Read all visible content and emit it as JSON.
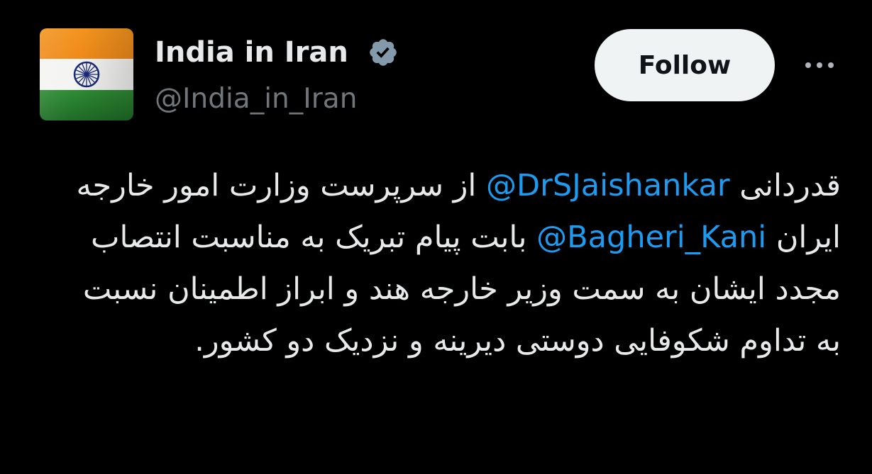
{
  "author": {
    "display_name": "India in Iran",
    "handle": "@India_in_Iran",
    "avatar_icon": "india-flag-icon",
    "verified_icon": "verified-badge-icon"
  },
  "actions": {
    "follow_label": "Follow",
    "more_icon": "more-horizontal-icon"
  },
  "tweet": {
    "text_part_1": "قدردانی ",
    "mention_1": "@DrSJaishankar",
    "text_part_2": " از سرپرست وزارت امور خارجه ایران ",
    "mention_2": "@Bagheri_Kani",
    "text_part_3": " بابت پیام تبریک به مناسبت انتصاب مجدد ایشان به سمت وزیر خارجه هند و ابراز اطمینان نسبت به تداوم شکوفایی دوستی دیرینه و نزدیک دو کشور."
  },
  "colors": {
    "background": "#000000",
    "text": "#e7e9ea",
    "secondary_text": "#71767b",
    "link": "#1d9bf0",
    "follow_bg": "#eff3f4",
    "follow_text": "#0f1419",
    "verified": "#829aab"
  }
}
